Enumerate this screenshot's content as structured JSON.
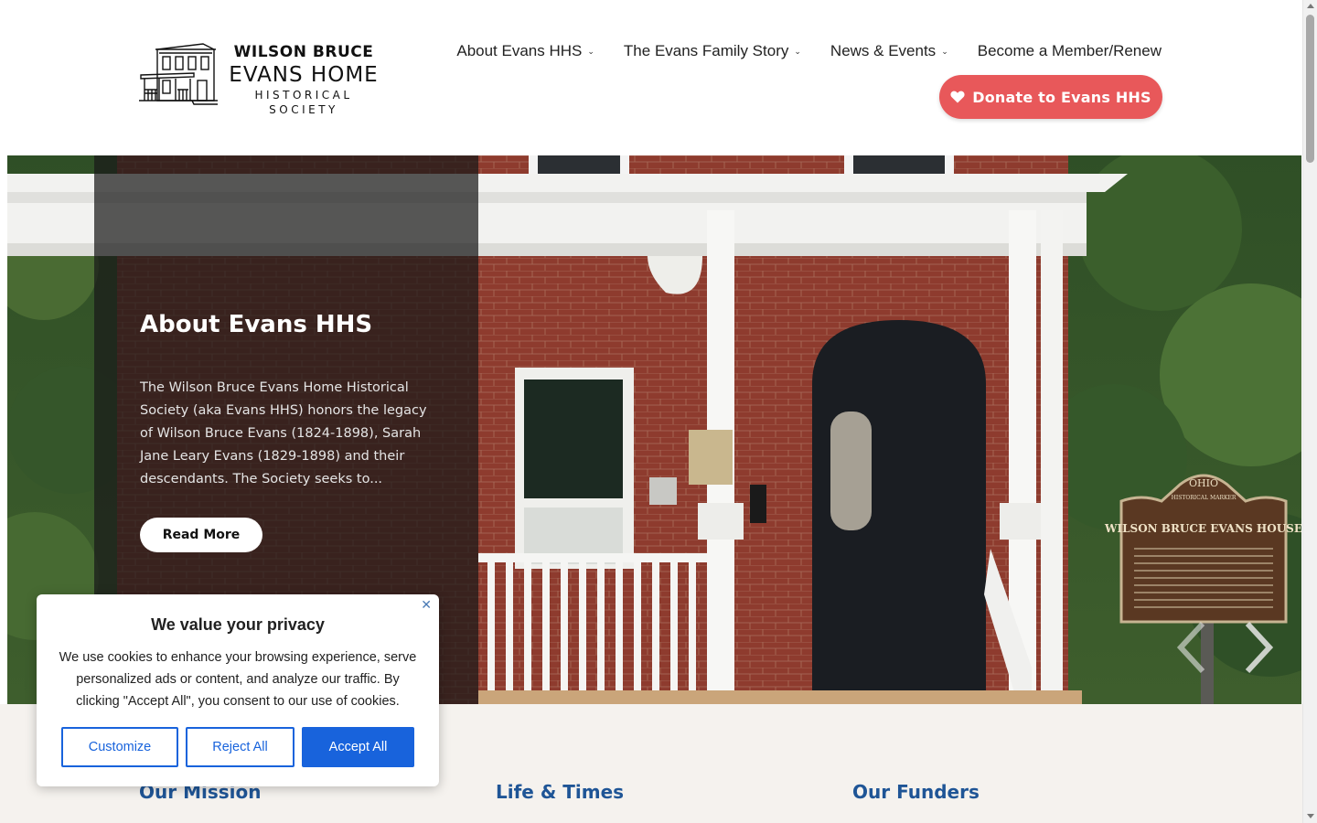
{
  "logo": {
    "line1": "WILSON BRUCE",
    "line2": "EVANS HOME",
    "line3": "HISTORICAL  SOCIETY"
  },
  "nav": {
    "items": [
      {
        "label": "About Evans HHS",
        "dropdown": true
      },
      {
        "label": "The Evans Family Story",
        "dropdown": true
      },
      {
        "label": "News & Events",
        "dropdown": true
      },
      {
        "label": "Become a Member/Renew",
        "dropdown": false
      }
    ],
    "donate_label": "Donate to Evans HHS",
    "donate_icon": "heart-icon",
    "donate_color": "#e8585a"
  },
  "hero": {
    "title": "About Evans HHS",
    "text": "The Wilson Bruce Evans Home Historical Society (aka Evans HHS) honors the legacy of Wilson Bruce Evans (1824-1898), Sarah Jane Leary Evans (1829-1898) and their descendants.  The Society seeks to...",
    "button_label": "Read More",
    "marker": {
      "state": "OHIO",
      "subtitle": "HISTORICAL MARKER",
      "title": "WILSON BRUCE EVANS HOUSE"
    },
    "prev_icon": "chevron-left-icon",
    "next_icon": "chevron-right-icon"
  },
  "sections": {
    "mission": "Our Mission",
    "life": "Life & Times",
    "funders": "Our Funders",
    "heading_color": "#1f5596"
  },
  "cookie": {
    "title": "We value your privacy",
    "text": "We use cookies to enhance your browsing experience, serve personalized ads or content, and analyze our traffic. By clicking \"Accept All\", you consent to our use of cookies.",
    "close_icon": "close-icon",
    "customize_label": "Customize",
    "reject_label": "Reject All",
    "accept_label": "Accept All",
    "accent_color": "#1863dc"
  }
}
